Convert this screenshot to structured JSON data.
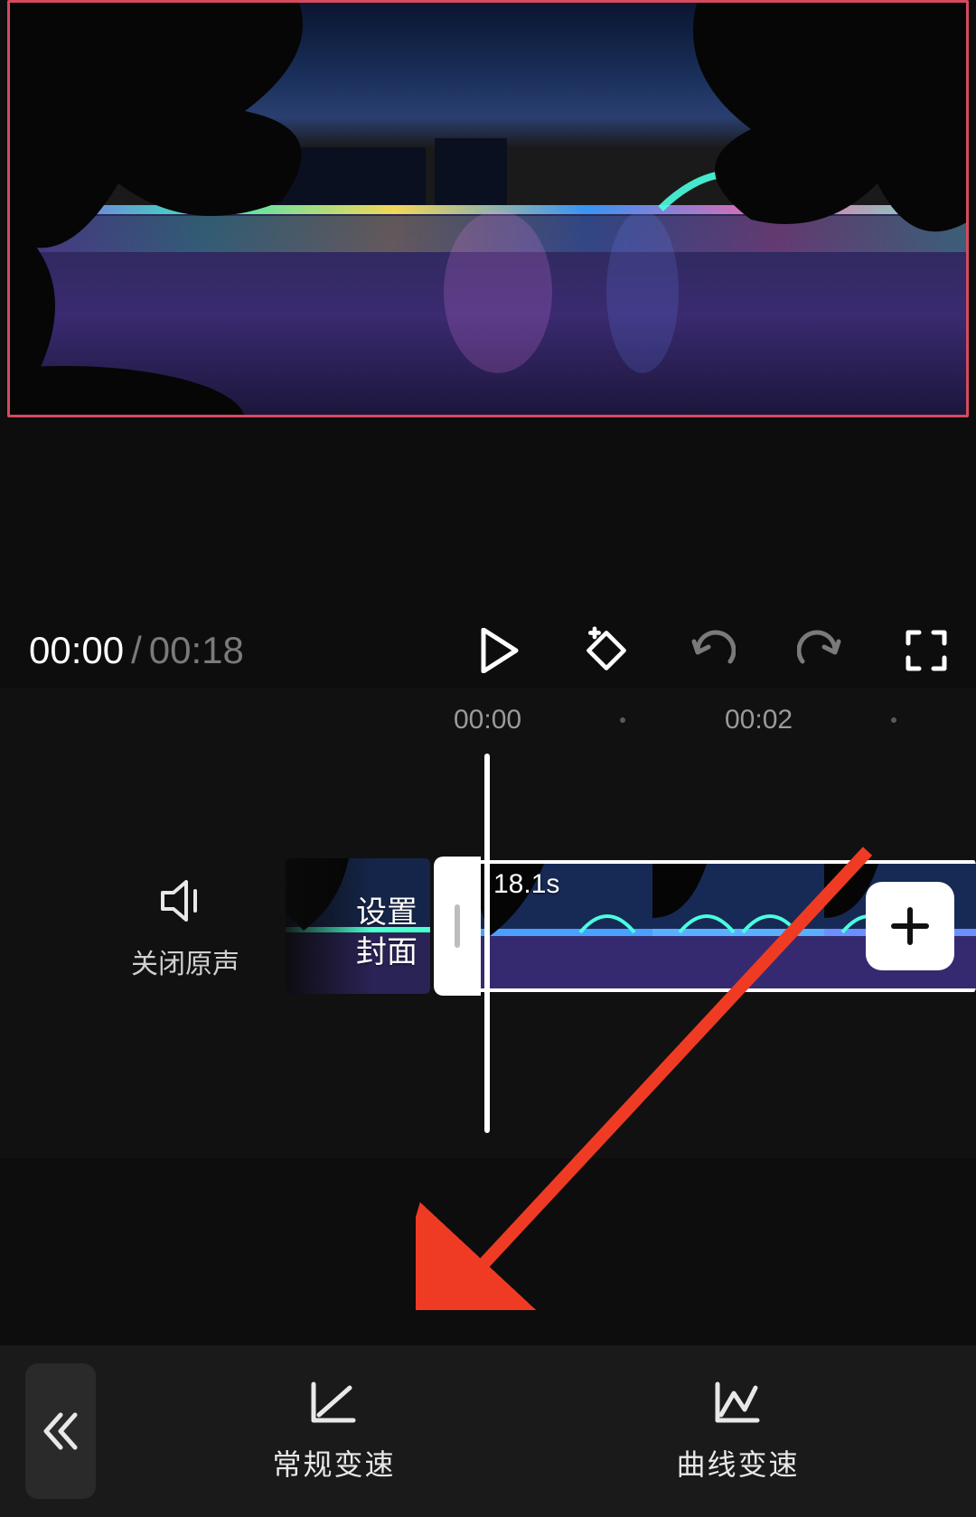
{
  "playback": {
    "current_time": "00:00",
    "separator": "/",
    "total_time": "00:18"
  },
  "ruler": {
    "label_1": "00:00",
    "label_2": "00:02"
  },
  "mute": {
    "label": "关闭原声"
  },
  "cover": {
    "label_line1": "设置",
    "label_line2": "封面"
  },
  "clip": {
    "duration": "18.1s"
  },
  "toolbar": {
    "normal_speed": "常规变速",
    "curve_speed": "曲线变速"
  },
  "colors": {
    "accent_border": "#d64a5f",
    "arrow": "#ef3b24"
  }
}
